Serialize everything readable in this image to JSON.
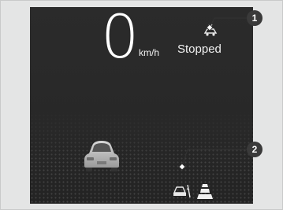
{
  "display": {
    "speed_value": "0",
    "speed_unit": "km/h",
    "status_text": "Stopped"
  },
  "callouts": [
    "1",
    "2"
  ],
  "icons": {
    "acc": "acc-stopped-car-icon",
    "vehicle": "lead-vehicle-icon",
    "lane_keep": "lane-keeping-car-icon",
    "lanes": "lane-lines-icon"
  },
  "colors": {
    "screen_bg": "#2a2a2a",
    "text": "#ffffff",
    "badge": "#3a3a3a",
    "page_bg": "#e4e5e5"
  }
}
